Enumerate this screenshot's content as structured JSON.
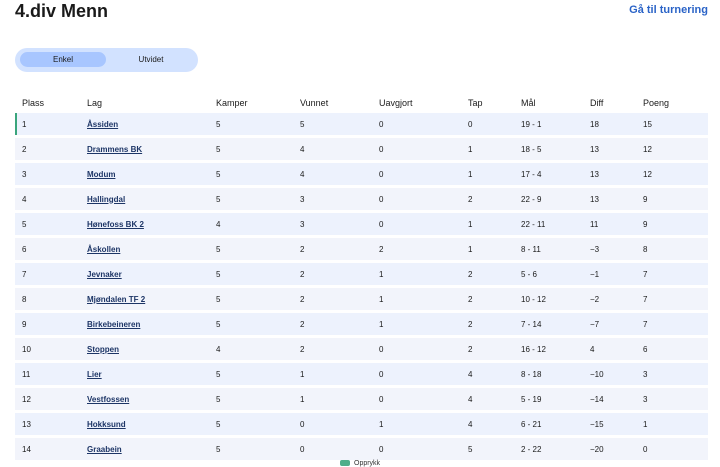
{
  "header": {
    "title": "4.div Menn",
    "tournament_link": "Gå til turnering"
  },
  "view_toggle": {
    "simple_label": "Enkel",
    "extended_label": "Utvidet"
  },
  "table": {
    "columns": [
      "Plass",
      "Lag",
      "Kamper",
      "Vunnet",
      "Uavgjort",
      "Tap",
      "Mål",
      "Diff",
      "Poeng"
    ],
    "rows": [
      {
        "plass": "1",
        "lag": "Åssiden",
        "kamper": "5",
        "vunnet": "5",
        "uavgjort": "0",
        "tap": "0",
        "maal": "19 - 1",
        "diff": "18",
        "poeng": "15"
      },
      {
        "plass": "2",
        "lag": "Drammens BK",
        "kamper": "5",
        "vunnet": "4",
        "uavgjort": "0",
        "tap": "1",
        "maal": "18 - 5",
        "diff": "13",
        "poeng": "12"
      },
      {
        "plass": "3",
        "lag": "Modum",
        "kamper": "5",
        "vunnet": "4",
        "uavgjort": "0",
        "tap": "1",
        "maal": "17 - 4",
        "diff": "13",
        "poeng": "12"
      },
      {
        "plass": "4",
        "lag": "Hallingdal",
        "kamper": "5",
        "vunnet": "3",
        "uavgjort": "0",
        "tap": "2",
        "maal": "22 - 9",
        "diff": "13",
        "poeng": "9"
      },
      {
        "plass": "5",
        "lag": "Hønefoss BK 2",
        "kamper": "4",
        "vunnet": "3",
        "uavgjort": "0",
        "tap": "1",
        "maal": "22 - 11",
        "diff": "11",
        "poeng": "9"
      },
      {
        "plass": "6",
        "lag": "Åskollen",
        "kamper": "5",
        "vunnet": "2",
        "uavgjort": "2",
        "tap": "1",
        "maal": "8 - 11",
        "diff": "−3",
        "poeng": "8"
      },
      {
        "plass": "7",
        "lag": "Jevnaker",
        "kamper": "5",
        "vunnet": "2",
        "uavgjort": "1",
        "tap": "2",
        "maal": "5 - 6",
        "diff": "−1",
        "poeng": "7"
      },
      {
        "plass": "8",
        "lag": "Mjøndalen TF 2",
        "kamper": "5",
        "vunnet": "2",
        "uavgjort": "1",
        "tap": "2",
        "maal": "10 - 12",
        "diff": "−2",
        "poeng": "7"
      },
      {
        "plass": "9",
        "lag": "Birkebeineren",
        "kamper": "5",
        "vunnet": "2",
        "uavgjort": "1",
        "tap": "2",
        "maal": "7 - 14",
        "diff": "−7",
        "poeng": "7"
      },
      {
        "plass": "10",
        "lag": "Stoppen",
        "kamper": "4",
        "vunnet": "2",
        "uavgjort": "0",
        "tap": "2",
        "maal": "16 - 12",
        "diff": "4",
        "poeng": "6"
      },
      {
        "plass": "11",
        "lag": "Lier",
        "kamper": "5",
        "vunnet": "1",
        "uavgjort": "0",
        "tap": "4",
        "maal": "8 - 18",
        "diff": "−10",
        "poeng": "3"
      },
      {
        "plass": "12",
        "lag": "Vestfossen",
        "kamper": "5",
        "vunnet": "1",
        "uavgjort": "0",
        "tap": "4",
        "maal": "5 - 19",
        "diff": "−14",
        "poeng": "3"
      },
      {
        "plass": "13",
        "lag": "Hokksund",
        "kamper": "5",
        "vunnet": "0",
        "uavgjort": "1",
        "tap": "4",
        "maal": "6 - 21",
        "diff": "−15",
        "poeng": "1"
      },
      {
        "plass": "14",
        "lag": "Graabein",
        "kamper": "5",
        "vunnet": "0",
        "uavgjort": "0",
        "tap": "5",
        "maal": "2 - 22",
        "diff": "−20",
        "poeng": "0"
      }
    ]
  },
  "legend": {
    "promotion_label": "Opprykk",
    "promotion_color": "#4fae8a"
  }
}
